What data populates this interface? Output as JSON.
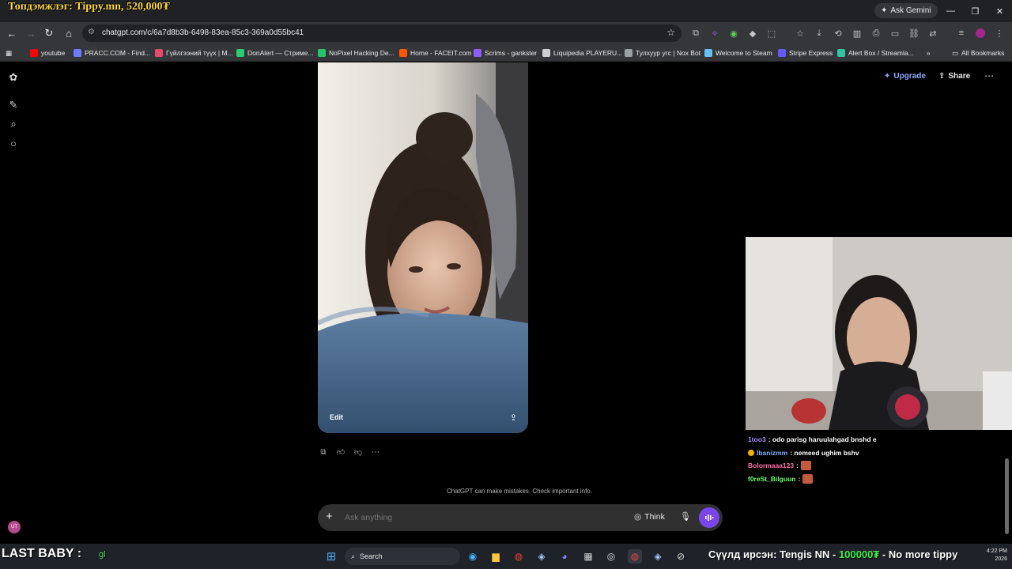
{
  "overlay": {
    "top_banner": "Топдэмжлэг: Tippy.mn, 520,000₮",
    "bottom_left": "LAST BABY :",
    "bottom_left_green": "gl",
    "ticker_label": "Сүүлд ирсэн:",
    "ticker_name": "Tengis NN -",
    "ticker_amount": "100000₮",
    "ticker_message": "- No more tippy"
  },
  "browser": {
    "ask_gemini": "Ask Gemini",
    "url": "chatgpt.com/c/6a7d8b3b-6498-83ea-85c3-369a0d55bc41",
    "bookmarks": [
      {
        "label": "youtube",
        "color": "#ff0000"
      },
      {
        "label": "PRACC.COM - Find...",
        "color": "#6a7cff"
      },
      {
        "label": "Гүйлгээний түүх | M...",
        "color": "#e84a6a"
      },
      {
        "label": "DonAlert — Стриме...",
        "color": "#2ecc71"
      },
      {
        "label": "NoPixel Hacking De...",
        "color": "#27c46a"
      },
      {
        "label": "Home - FACEIT.com",
        "color": "#ff5500"
      },
      {
        "label": "Scrims - gankster",
        "color": "#8e5cf7"
      },
      {
        "label": "Liquipedia PLAYERU...",
        "color": "#cfcfcf"
      },
      {
        "label": "Тулхуур угс | Nox Bot",
        "color": "#9aa0a6"
      },
      {
        "label": "Welcome to Steam",
        "color": "#66c0f4"
      },
      {
        "label": "Stripe Express",
        "color": "#635bff"
      },
      {
        "label": "Alert Box / Streamla...",
        "color": "#31c3a2"
      }
    ],
    "all_bookmarks": "All Bookmarks"
  },
  "chatgpt": {
    "upgrade": "Upgrade",
    "share": "Share",
    "image_edit": "Edit",
    "disclaimer": "ChatGPT can make mistakes. Check important info.",
    "composer_placeholder": "Ask anything",
    "think": "Think",
    "avatar_initials": "UT",
    "accent": "#7b46e8"
  },
  "stream_chat": [
    {
      "user": "1too3",
      "color": "#a88bff",
      "text": ": odo parisg haruulahgad bnshd e",
      "emote": false
    },
    {
      "user": "Ibanizmm",
      "color": "#7fb2ff",
      "text": ": nemeed ughim bshv",
      "emote": false,
      "badge": true
    },
    {
      "user": "Bolormaaa123",
      "color": "#ff6fa8",
      "text": ":",
      "emote": true
    },
    {
      "user": "f0reSt_Bilguun",
      "color": "#6dff6d",
      "text": ":",
      "emote": true
    }
  ],
  "taskbar": {
    "search": "Search",
    "time": "4:22 PM",
    "date": "2026"
  }
}
